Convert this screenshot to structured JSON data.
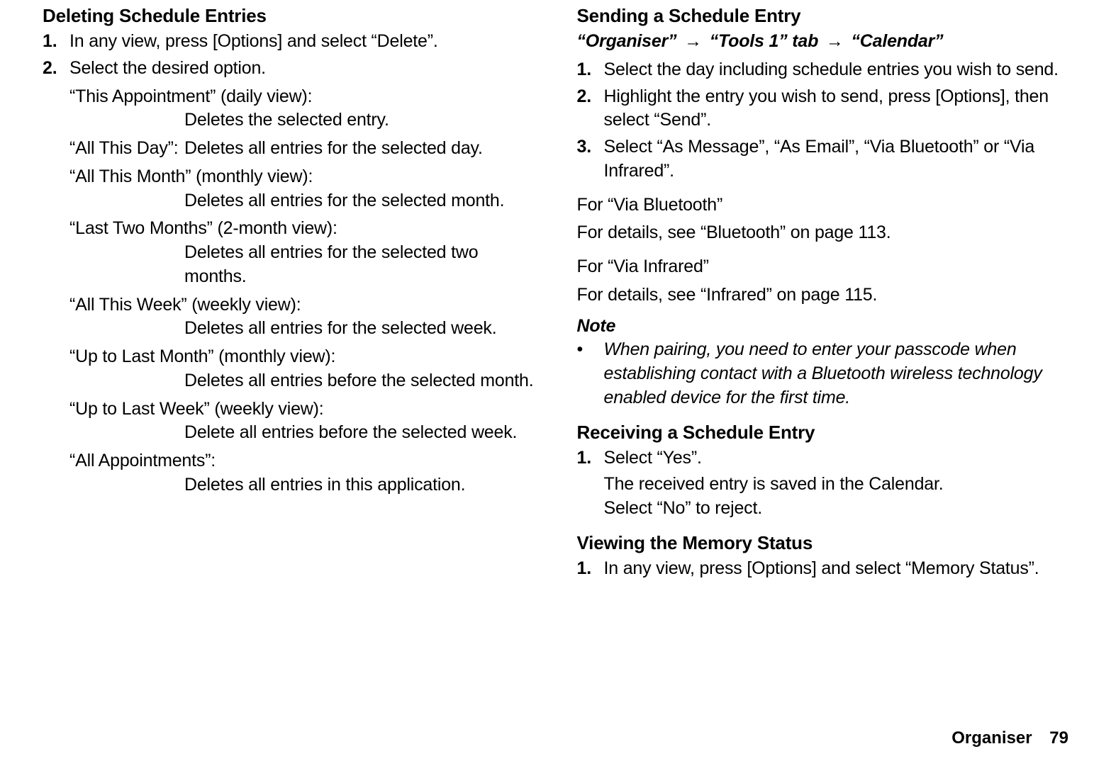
{
  "left": {
    "heading": "Deleting Schedule Entries",
    "steps": [
      {
        "num": "1.",
        "text": "In any view, press [Options] and select “Delete”."
      },
      {
        "num": "2.",
        "text": "Select the desired option."
      }
    ],
    "options": [
      {
        "term": "“This Appointment” (daily view):",
        "desc": "Deletes the selected entry.",
        "wrap": true
      },
      {
        "term": "“All This Day”:",
        "desc": "Deletes all entries for the selected day.",
        "wrap": false
      },
      {
        "term": "“All This Month” (monthly view):",
        "desc": "Deletes all entries for the selected month.",
        "wrap": true
      },
      {
        "term": "“Last Two Months” (2-month view):",
        "desc": "Deletes all entries for the selected two months.",
        "wrap": true
      },
      {
        "term": "“All This Week” (weekly view):",
        "desc": "Deletes all entries for the selected week.",
        "wrap": true
      },
      {
        "term": "“Up to Last Month” (monthly view):",
        "desc": "Deletes all entries before the selected month.",
        "wrap": true
      },
      {
        "term": "“Up to Last Week” (weekly view):",
        "desc": "Delete all entries before the selected week.",
        "wrap": true
      },
      {
        "term": "“All Appointments”:",
        "desc": "Deletes all entries in this application.",
        "wrap": true
      }
    ]
  },
  "right": {
    "send_heading": "Sending a Schedule Entry",
    "nav_parts": [
      "“Organiser”",
      "“Tools 1” tab",
      "“Calendar”"
    ],
    "nav_arrow": "→",
    "send_steps": [
      {
        "num": "1.",
        "text": "Select the day including schedule entries you wish to send."
      },
      {
        "num": "2.",
        "text": "Highlight the entry you wish to send, press [Options], then select “Send”."
      },
      {
        "num": "3.",
        "text": "Select “As Message”, “As Email”, “Via Bluetooth” or “Via Infrared”."
      }
    ],
    "bt_head": "For “Via Bluetooth”",
    "bt_text": "For details, see “Bluetooth” on page 113.",
    "ir_head": "For “Via Infrared”",
    "ir_text": "For details, see “Infrared” on page 115.",
    "note_head": "Note",
    "note_bullet": "•",
    "note_text": "When pairing, you need to enter your passcode when establishing contact with a Bluetooth wireless technology enabled device for the first time.",
    "recv_heading": "Receiving a Schedule Entry",
    "recv_steps": [
      {
        "num": "1.",
        "text": "Select “Yes”."
      }
    ],
    "recv_sub1": "The received entry is saved in the Calendar.",
    "recv_sub2": "Select “No” to reject.",
    "mem_heading": "Viewing the Memory Status",
    "mem_steps": [
      {
        "num": "1.",
        "text": "In any view, press [Options] and select “Memory Status”."
      }
    ]
  },
  "footer": {
    "section": "Organiser",
    "page": "79"
  }
}
